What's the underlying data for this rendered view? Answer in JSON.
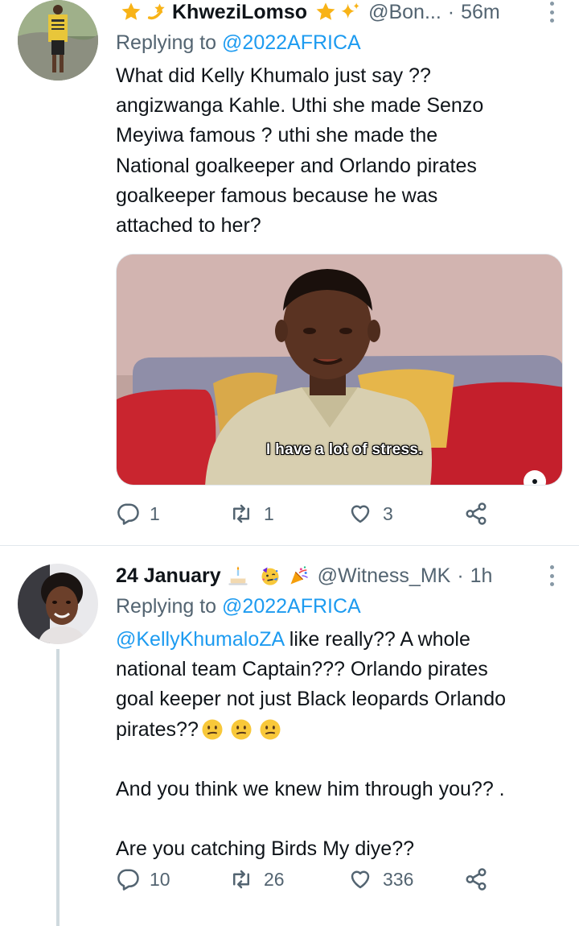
{
  "tweets": [
    {
      "display_name": "KhweziLomso",
      "handle": "@Bon...",
      "dot": "·",
      "time": "56m",
      "replying_prefix": "Replying to",
      "replying_to": "@2022AFRICA",
      "text_lines": [
        "What did Kelly Khumalo just say ??",
        "angizwanga Kahle. Uthi she made Senzo",
        "Meyiwa famous ? uthi she made the",
        "National goalkeeper and Orlando pirates",
        "goalkeeper famous because he was",
        "attached to her?"
      ],
      "media_caption": "I have a lot of stress.",
      "replies": "1",
      "retweets": "1",
      "likes": "3",
      "name_decor_icons": [
        "star-emoji",
        "dizzy-emoji",
        "star-emoji",
        "sparkles-emoji"
      ]
    },
    {
      "display_name": "24 January",
      "handle": "@Witness_MK",
      "dot": "·",
      "time": "1h",
      "replying_prefix": "Replying to",
      "replying_to": "@2022AFRICA",
      "mention": "@KellyKhumaloZA",
      "text_lines": [
        " like really?? A whole",
        "national team Captain??? Orlando pirates",
        "goal keeper not just Black leopards Orlando",
        "pirates??"
      ],
      "paragraph2": "And you think we knew him through you?? .",
      "paragraph3": "Are you catching Birds My diye??",
      "replies": "10",
      "retweets": "26",
      "likes": "336",
      "name_decor_icons": [
        "birthday-cake-emoji",
        "partying-face-emoji",
        "party-popper-emoji"
      ],
      "text_emojis": [
        "confused-face-emoji",
        "confused-face-emoji",
        "confused-face-emoji"
      ]
    }
  ],
  "colors": {
    "link": "#1d9bf0",
    "secondary_text": "#536471",
    "primary_text": "#0f1419"
  }
}
